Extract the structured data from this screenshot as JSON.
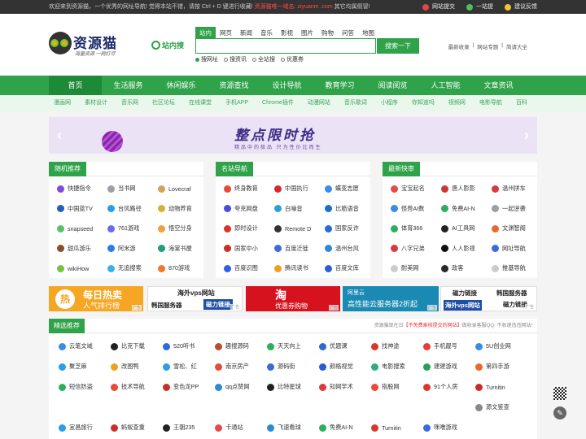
{
  "topbar": {
    "notice_prefix": "欢迎来到资源猫，一个优秀的网址导航! 觉得本站不错，请按 Ctrl + D 键进行收藏!",
    "notice_red": "资源猫唯一域名: ziyuanm .com",
    "notice_suffix": "其它均属假冒!",
    "links": [
      {
        "label": "网站提交",
        "icon": "fire-icon",
        "color": "#e64545"
      },
      {
        "label": "一站提",
        "icon": "paper-plane-icon",
        "color": "#4cc15b"
      },
      {
        "label": "建议反馈",
        "icon": "lightbulb-icon",
        "color": "#f1c232"
      }
    ]
  },
  "logo": {
    "name": "资源猫",
    "slogan": "海量资源 一网打尽"
  },
  "search": {
    "site_search_label": "站内搜",
    "tabs": [
      "站内",
      "网页",
      "新闻",
      "音乐",
      "影视",
      "图片",
      "购物",
      "问答",
      "地图"
    ],
    "active_tab": 0,
    "placeholder": "",
    "button": "搜索一下",
    "radios": [
      "搜网址",
      "搜资讯",
      "全站搜",
      "优惠券"
    ],
    "active_radio": 0
  },
  "header_links": [
    "最新收录",
    "|",
    "网站专题",
    "|",
    "简请大全"
  ],
  "nav": [
    "首页",
    "生活服务",
    "休闲娱乐",
    "资源查找",
    "设计导航",
    "教育学习",
    "阅读阅览",
    "人工智能",
    "文章资讯"
  ],
  "subnav": [
    "漫画网",
    "素材设计",
    "音乐网",
    "社区论坛",
    "在线课堂",
    "手机APP",
    "Chrome插件",
    "动漫网站",
    "音乐歌词",
    "小程序",
    "你知道吗",
    "视频网",
    "电影导航",
    "百科"
  ],
  "banner": {
    "title": "整点限时抢",
    "subtitle": "精品中的极品 只为性价比而生",
    "prev": "‹",
    "next": "›"
  },
  "boxes": [
    {
      "title": "随机推荐",
      "items": [
        {
          "label": "快捷指令",
          "color": "#7b4fd6"
        },
        {
          "label": "当书网",
          "color": "#9aa0a6"
        },
        {
          "label": "Lovecraf",
          "color": "#d2a35a"
        },
        {
          "label": "中国蓝TV",
          "color": "#1f5fbf"
        },
        {
          "label": "台风路径",
          "color": "#2a9de8"
        },
        {
          "label": "动物养育",
          "color": "#d7b03a"
        },
        {
          "label": "snapseed",
          "color": "#55c266"
        },
        {
          "label": "761游戏",
          "color": "#6a6af0"
        },
        {
          "label": "悟空分身",
          "color": "#f0a23a"
        },
        {
          "label": "甜瓜游乐",
          "color": "#8a4d2a"
        },
        {
          "label": "阿米游",
          "color": "#2a7be8"
        },
        {
          "label": "海棠书屋",
          "color": "#1f9e7a"
        },
        {
          "label": "wikiHow",
          "color": "#7bc043"
        },
        {
          "label": "无追搜索",
          "color": "#39b0e8"
        },
        {
          "label": "870游戏",
          "color": "#f07a2a"
        }
      ]
    },
    {
      "title": "名站导航",
      "items": [
        {
          "label": "终身教育",
          "color": "#e8483a"
        },
        {
          "label": "中国执行",
          "color": "#d32b2b"
        },
        {
          "label": "蝶变志愿",
          "color": "#3a8de8"
        },
        {
          "label": "夸克网盘",
          "color": "#4a4ae0"
        },
        {
          "label": "白噪音",
          "color": "#2aa0d8"
        },
        {
          "label": "比筋语音",
          "color": "#1a6fd0"
        },
        {
          "label": "即时设计",
          "color": "#d8352a"
        },
        {
          "label": "Remote D",
          "color": "#333333"
        },
        {
          "label": "国家反诈",
          "color": "#2a6ad8"
        },
        {
          "label": "国家中小",
          "color": "#c8302a"
        },
        {
          "label": "百度迁徙",
          "color": "#3a6be0"
        },
        {
          "label": "温州台风",
          "color": "#2a8ad8"
        },
        {
          "label": "百度识图",
          "color": "#3060e0"
        },
        {
          "label": "腾讯读书",
          "color": "#f0a020"
        },
        {
          "label": "百度文库",
          "color": "#2a5fd8"
        }
      ]
    },
    {
      "title": "最新快审",
      "items": [
        {
          "label": "宝宝起名",
          "color": "#e84a4a"
        },
        {
          "label": "唐人影影",
          "color": "#c83a3a"
        },
        {
          "label": "温州拼车",
          "color": "#d83a3a"
        },
        {
          "label": "怪兽AI数",
          "color": "#3a8ae8"
        },
        {
          "label": "免费AI-N",
          "color": "#2ab05a"
        },
        {
          "label": "一起逆袭",
          "color": "#9aa0a6"
        },
        {
          "label": "体育366",
          "color": "#2ab05a"
        },
        {
          "label": "AI工具网",
          "color": "#222222"
        },
        {
          "label": "文渊智阁",
          "color": "#e86a2a"
        },
        {
          "label": "八字兄弟",
          "color": "#d83a3a"
        },
        {
          "label": "人人影视",
          "color": "#111111"
        },
        {
          "label": "网址导航",
          "color": "#3a6ae0"
        },
        {
          "label": "耐美网",
          "color": "#cccccc"
        },
        {
          "label": "政客",
          "color": "#2a2a2a"
        },
        {
          "label": "推基导航",
          "color": "#cccccc"
        }
      ]
    }
  ],
  "ads": {
    "ad1": {
      "circle": "热",
      "l1": "每日热卖",
      "l2": "人气排行榜",
      "tag": "广告"
    },
    "ad2": {
      "l1": "海外vps网站",
      "l2": "韩国服务器",
      "l3": "磁力链接",
      "tag": "广告"
    },
    "ad3": {
      "l1": "淘",
      "l2": "优惠券购物",
      "tag": "广告"
    },
    "ad4": {
      "l1": "阿里云",
      "l2": "高性能云服务器2折起",
      "tag": "广告"
    },
    "ad5": {
      "l1": "磁力链接",
      "l2": "韩国服务器",
      "l3": "海外vps网站",
      "l4": "磁力链接",
      "tag": "广告"
    }
  },
  "featured": {
    "title": "精选推荐",
    "note_prefix": "资源猫现在日",
    "note_red": "【不免费乘核提交的网站】",
    "note_suffix": "做收录客服QQ: 不收速违违网站!",
    "items": [
      {
        "label": "云笔文域",
        "color": "#3a8ae8"
      },
      {
        "label": "比克下载",
        "color": "#222222"
      },
      {
        "label": "520听书",
        "color": "#2a6ae0"
      },
      {
        "label": "趣搜源码",
        "color": "#c04a2a"
      },
      {
        "label": "天天向上",
        "color": "#2ab05a"
      },
      {
        "label": "优题课",
        "color": "#2a6ad8"
      },
      {
        "label": "找神途",
        "color": "#d83a2a"
      },
      {
        "label": "手机靓号",
        "color": "#e83a3a"
      },
      {
        "label": "5U创业网",
        "color": "#3a8ae8"
      },
      {
        "label": "聚芝麻",
        "color": "#2a9ee8"
      },
      {
        "label": "改图鸭",
        "color": "#f0a020"
      },
      {
        "label": "雪松、红",
        "color": "#2a9ee8"
      },
      {
        "label": "南京房产",
        "color": "#e84a3a"
      },
      {
        "label": "源码街",
        "color": "#3a6ad8"
      },
      {
        "label": "颜格视觉",
        "color": "#2a5ad8"
      },
      {
        "label": "电影搜索",
        "color": "#2ab07a"
      },
      {
        "label": "建建游戏",
        "color": "#2a9e5a"
      },
      {
        "label": "第四手游",
        "color": "#e86a2a"
      },
      {
        "label": "短信防盗",
        "color": "#2ab05a"
      },
      {
        "label": "技术导航",
        "color": "#e84a3a"
      },
      {
        "label": "变色龙PP",
        "color": "#c8302a"
      },
      {
        "label": "qq点赞网",
        "color": "#2a8ad8"
      },
      {
        "label": "比特星球",
        "color": "#222222"
      },
      {
        "label": "知网学术",
        "color": "#d83a3a"
      },
      {
        "label": "指股网",
        "color": "#e84a3a"
      },
      {
        "label": "91个人房",
        "color": "#d83a2a"
      },
      {
        "label": "Turnitin",
        "color": "#cc2a2a"
      },
      {
        "label": "",
        "color": ""
      },
      {
        "label": "",
        "color": ""
      },
      {
        "label": "",
        "color": ""
      },
      {
        "label": "",
        "color": ""
      },
      {
        "label": "",
        "color": ""
      },
      {
        "label": "",
        "color": ""
      },
      {
        "label": "",
        "color": ""
      },
      {
        "label": "",
        "color": ""
      },
      {
        "label": "源文鉴查",
        "color": "#888888"
      },
      {
        "label": "宜昌旅行",
        "color": "#2a9ee8"
      },
      {
        "label": "蚂蚁查重",
        "color": "#c8302a"
      },
      {
        "label": "王朝235",
        "color": "#222222"
      },
      {
        "label": "卡通站",
        "color": "#e84a4a"
      },
      {
        "label": "飞速看球",
        "color": "#2a8ad8"
      },
      {
        "label": "免费AI-N",
        "color": "#2ab05a"
      },
      {
        "label": "Turnitin",
        "color": "#d83a2a"
      },
      {
        "label": "咪噜游戏",
        "color": "#3a6ae0"
      },
      {
        "label": "",
        "color": ""
      }
    ]
  },
  "side": {
    "edit_icon": "✎"
  }
}
